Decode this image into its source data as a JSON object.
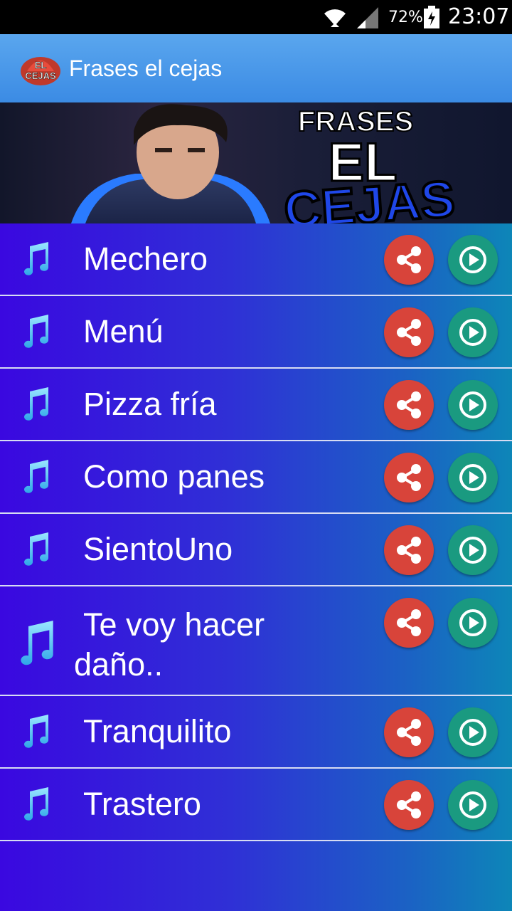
{
  "status_bar": {
    "battery": "72%",
    "time": "23:07"
  },
  "app_bar": {
    "title": "Frases el cejas",
    "logo_text": "EL CEJAS"
  },
  "banner": {
    "line1": "FRASES",
    "line2": "EL",
    "line3": "CEJAS"
  },
  "items": [
    {
      "label": "Mechero"
    },
    {
      "label": "Menú"
    },
    {
      "label": "Pizza fría"
    },
    {
      "label": "Como panes"
    },
    {
      "label": "SientoUno"
    },
    {
      "label": "Te voy hacer daño.."
    },
    {
      "label": "Tranquilito"
    },
    {
      "label": "Trastero"
    }
  ],
  "icons": {
    "row_icon": "music-note-icon",
    "share": "share-icon",
    "play": "play-icon"
  },
  "colors": {
    "share_button": "#d8443a",
    "play_button": "#1a9a80",
    "app_bar": "#3b8be4"
  }
}
